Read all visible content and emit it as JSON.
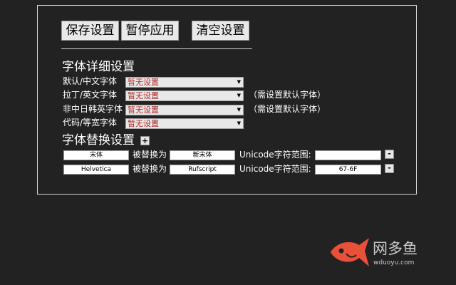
{
  "toolbar": {
    "save_label": "保存设置",
    "pause_label": "暂停应用",
    "clear_label": "清空设置"
  },
  "detail_section": {
    "title": "字体详细设置",
    "rows": [
      {
        "label": "默认/中文字体",
        "value": "暂无设置",
        "note": ""
      },
      {
        "label": "拉丁/英文字体",
        "value": "暂无设置",
        "note": "（需设置默认字体）"
      },
      {
        "label": "非中日韩英字体",
        "value": "暂无设置",
        "note": "（需设置默认字体）"
      },
      {
        "label": "代码/等宽字体",
        "value": "暂无设置",
        "note": ""
      }
    ]
  },
  "replace_section": {
    "title": "字体替换设置",
    "add_label": "+",
    "replaced_by_label": "被替换为",
    "range_label": "Unicode字符范围:",
    "remove_label": "-",
    "rows": [
      {
        "source": "宋体",
        "target": "新宋体",
        "range": ""
      },
      {
        "source": "Helvetica",
        "target": "Rufscript",
        "range": "67-6F"
      }
    ]
  },
  "watermark": {
    "name": "网多鱼",
    "url": "wduoyu.com"
  },
  "colors": {
    "background": "#222222",
    "select_text": "#b02a2a",
    "logo": "#e8503a"
  }
}
